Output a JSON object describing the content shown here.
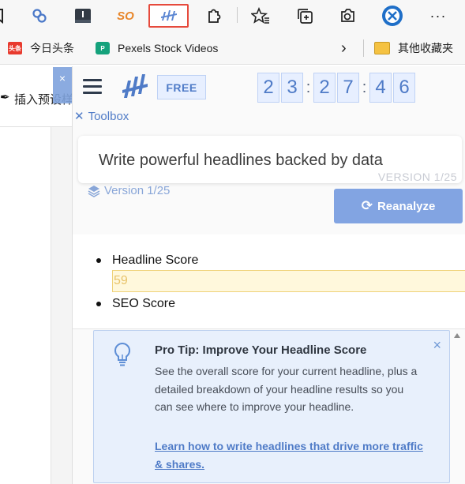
{
  "toolbar": {
    "icons": [
      "bookmark-cut-icon",
      "link-icon",
      "dark-panel-icon",
      "so-search-icon",
      "headline-analyzer-icon",
      "extensions-puzzle-icon",
      "favorites-star-icon",
      "collections-icon",
      "browser-essentials-icon",
      "edge-profile-icon",
      "more-menu-icon"
    ],
    "so_text": "SO",
    "more_text": "···"
  },
  "bookmarks": {
    "items": [
      {
        "label": "今日头条",
        "icon_text": "头条",
        "icon_color": "#e83a2e"
      },
      {
        "label": "Pexels Stock Videos",
        "icon_text": "P",
        "icon_color": "#15a27c"
      }
    ],
    "overflow": "›",
    "folder_label": "其他收藏夹"
  },
  "background_page": {
    "insert_text": "插入预设样式"
  },
  "panel": {
    "close_tab_text": "×",
    "free_badge": "FREE",
    "timer": [
      "2",
      "3",
      "2",
      "7",
      "4",
      "6"
    ],
    "toolbox_label": "Toolbox",
    "headline_text": "Write powerful headlines backed by data",
    "version_watermark": "VERSION 1/25",
    "version_label": "Version 1/25",
    "reanalyze_label": "Reanalyze",
    "scores": {
      "headline_label": "Headline Score",
      "headline_value": "59",
      "seo_label": "SEO Score"
    },
    "protip": {
      "title": "Pro Tip: Improve Your Headline Score",
      "body": "See the overall score for your current headline, plus a detailed breakdown of your headline results so you can see where to improve your headline.",
      "link": "Learn how to write headlines that drive more traffic & shares.",
      "close": "×"
    }
  },
  "colors": {
    "accent": "#4f7bc7",
    "button": "#82a4e2",
    "score_bg": "#fff8dc",
    "tip_bg": "#e8f0fc"
  }
}
